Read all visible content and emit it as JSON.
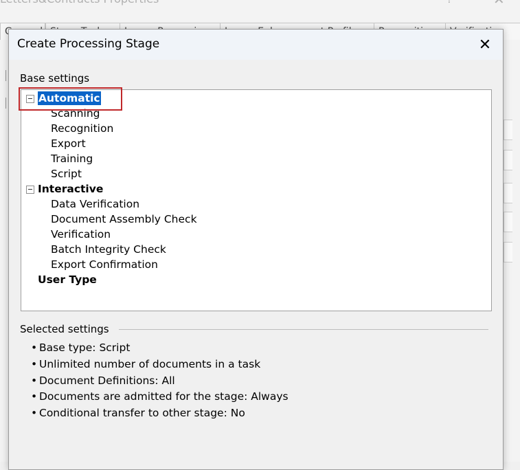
{
  "background_window": {
    "title": "Letters&Contracts Properties",
    "help_label": "?",
    "close_label": "✕",
    "tabs": [
      "General",
      "Stage Tools",
      "Image Processing",
      "Image Enhancement Profiles",
      "Recognition",
      "Verification"
    ]
  },
  "dialog": {
    "title": "Create Processing Stage",
    "close_label": "✕",
    "base_settings_label": "Base settings",
    "tree": {
      "automatic": {
        "label": "Automatic",
        "children": [
          "Scanning",
          "Recognition",
          "Export",
          "Training",
          "Script"
        ]
      },
      "interactive": {
        "label": "Interactive",
        "children": [
          "Data Verification",
          "Document Assembly Check",
          "Verification",
          "Batch Integrity Check",
          "Export Confirmation"
        ]
      },
      "user_type": {
        "label": "User Type"
      },
      "selected": "Automatic"
    },
    "selected_settings_label": "Selected settings",
    "selected_settings": [
      "Base type: Script",
      "Unlimited number of documents in a task",
      "Document Definitions: All",
      "Documents are admitted for the stage: Always",
      "Conditional transfer to other stage: No"
    ]
  },
  "colors": {
    "selection": "#0a64c8",
    "highlight_box": "#c0282a"
  }
}
